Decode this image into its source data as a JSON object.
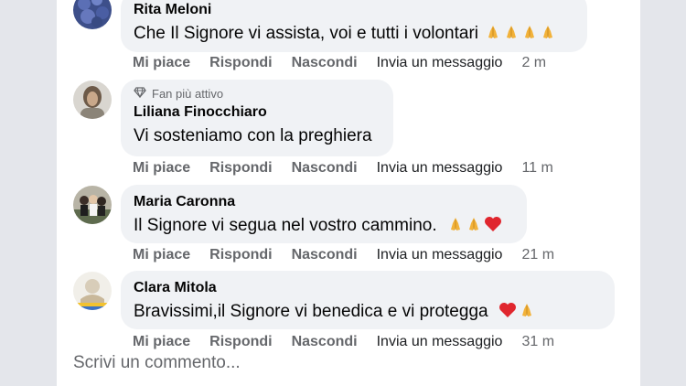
{
  "actions": {
    "like": "Mi piace",
    "reply": "Rispondi",
    "hide": "Nascondi",
    "message": "Invia un messaggio"
  },
  "comments": [
    {
      "author": "Rita Meloni",
      "text": "Che Il Signore vi assista, voi e tutti i volontari",
      "emoji": [
        "praying-hands",
        "praying-hands",
        "praying-hands",
        "praying-hands"
      ],
      "time": "2 m"
    },
    {
      "badge": "Fan più attivo",
      "author": "Liliana Finocchiaro",
      "text": "Vi sosteniamo con la preghiera",
      "emoji": [],
      "time": "11 m"
    },
    {
      "author": "Maria Caronna",
      "text": "Il Signore vi segua nel vostro cammino.",
      "emoji": [
        "praying-hands",
        "praying-hands",
        "red-heart"
      ],
      "time": "21 m"
    },
    {
      "author": "Clara Mitola",
      "text": "Bravissimi,il Signore vi benedica e vi protegga",
      "emoji": [
        "red-heart",
        "praying-hands"
      ],
      "time": "31 m"
    }
  ],
  "composer": {
    "placeholder": "Scrivi un commento..."
  },
  "colors": {
    "bubble": "#f0f2f5",
    "page": "#e4e6eb",
    "meta": "#65676b"
  }
}
